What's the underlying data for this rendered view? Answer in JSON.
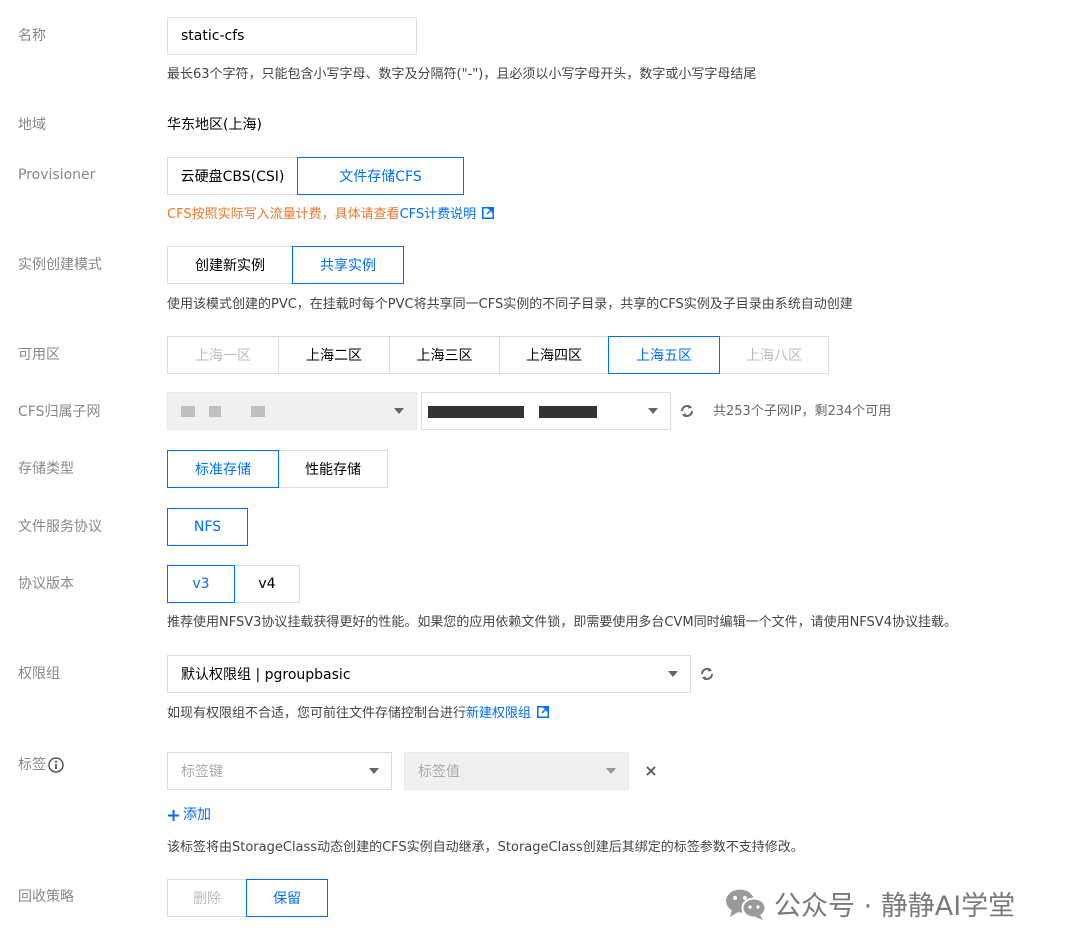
{
  "form": {
    "name": {
      "label": "名称",
      "value": "static-cfs",
      "hint": "最长63个字符，只能包含小写字母、数字及分隔符(\"-\")，且必须以小写字母开头，数字或小写字母结尾"
    },
    "region": {
      "label": "地域",
      "value": "华东地区(上海)"
    },
    "provisioner": {
      "label": "Provisioner",
      "options": [
        "云硬盘CBS(CSI)",
        "文件存储CFS"
      ],
      "selected": "文件存储CFS",
      "note_prefix": "CFS按照实际写入流量计费，具体请查看",
      "note_link": "CFS计费说明"
    },
    "instance_mode": {
      "label": "实例创建模式",
      "options": [
        "创建新实例",
        "共享实例"
      ],
      "selected": "共享实例",
      "hint": "使用该模式创建的PVC，在挂载时每个PVC将共享同一CFS实例的不同子目录，共享的CFS实例及子目录由系统自动创建"
    },
    "zone": {
      "label": "可用区",
      "options": [
        "上海一区",
        "上海二区",
        "上海三区",
        "上海四区",
        "上海五区",
        "上海八区"
      ],
      "disabled": [
        "上海一区",
        "上海八区"
      ],
      "selected": "上海五区"
    },
    "subnet": {
      "label": "CFS归属子网",
      "info": "共253个子网IP，剩234个可用"
    },
    "storage_type": {
      "label": "存储类型",
      "options": [
        "标准存储",
        "性能存储"
      ],
      "selected": "标准存储"
    },
    "protocol": {
      "label": "文件服务协议",
      "options": [
        "NFS"
      ],
      "selected": "NFS"
    },
    "protocol_version": {
      "label": "协议版本",
      "options": [
        "v3",
        "v4"
      ],
      "selected": "v3",
      "hint": "推荐使用NFSV3协议挂载获得更好的性能。如果您的应用依赖文件锁，即需要使用多台CVM同时编辑一个文件，请使用NFSV4协议挂载。"
    },
    "permission_group": {
      "label": "权限组",
      "value": "默认权限组 | pgroupbasic",
      "hint_prefix": "如现有权限组不合适，您可前往文件存储控制台进行",
      "hint_link": "新建权限组"
    },
    "tags": {
      "label": "标签",
      "key_placeholder": "标签键",
      "value_placeholder": "标签值",
      "add_label": "添加",
      "hint": "该标签将由StorageClass动态创建的CFS实例自动继承，StorageClass创建后其绑定的标签参数不支持修改。"
    },
    "reclaim": {
      "label": "回收策略",
      "options": [
        "删除",
        "保留"
      ],
      "selected": "保留"
    }
  },
  "watermark": {
    "text": "公众号 · 静静AI学堂"
  },
  "colors": {
    "accent": "#006eff",
    "warning": "#e8772e",
    "label": "#888888"
  }
}
